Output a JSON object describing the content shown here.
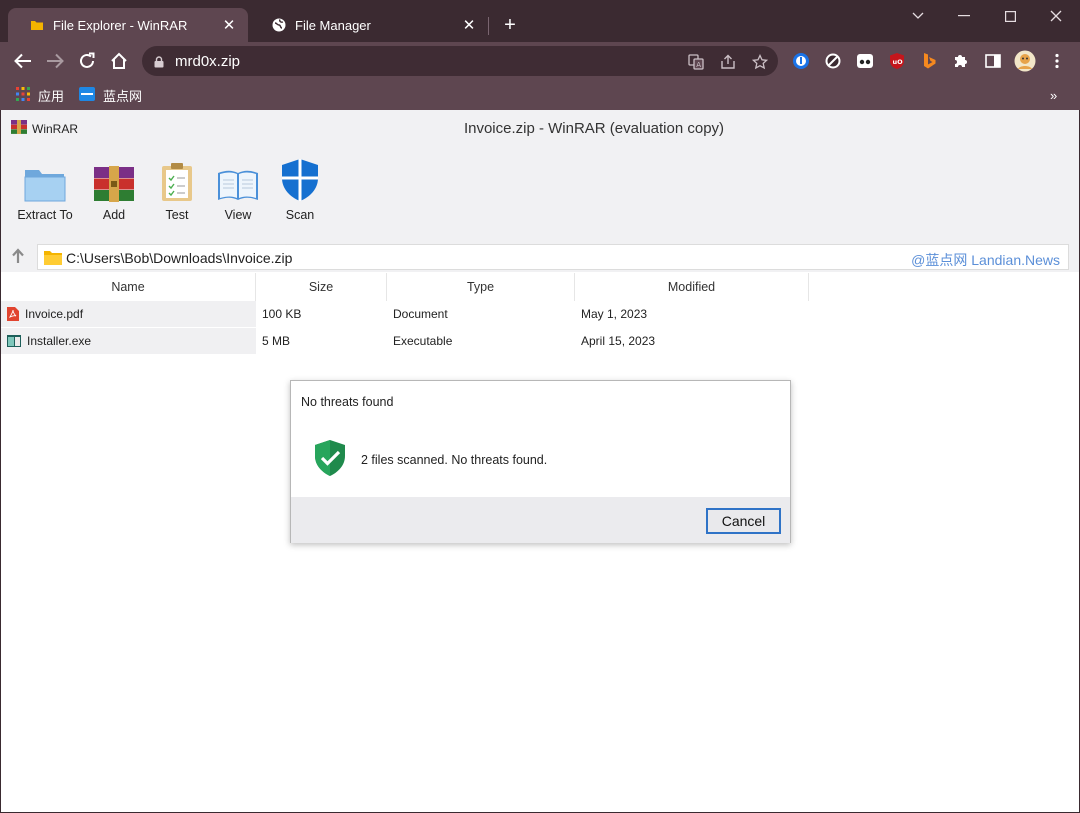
{
  "browser": {
    "tabs": [
      {
        "title": "File Explorer - WinRAR",
        "icon": "folder-icon",
        "active": true
      },
      {
        "title": "File Manager",
        "icon": "globe-icon",
        "active": false
      }
    ],
    "new_tab_label": "+",
    "address": "mrd0x.zip",
    "bookmarks": [
      {
        "label": "应用",
        "icon": "apps-grid-icon"
      },
      {
        "label": "蓝点网",
        "icon": "bookmark-site-icon"
      }
    ],
    "bookmarks_overflow": "»",
    "frame_color": "#3b2a31",
    "toolbar_color": "#5e4650"
  },
  "app": {
    "brand": "WinRAR",
    "window_title": "Invoice.zip - WinRAR (evaluation copy)",
    "tools": [
      {
        "label": "Extract To",
        "icon": "folder-icon"
      },
      {
        "label": "Add",
        "icon": "winrar-books-icon"
      },
      {
        "label": "Test",
        "icon": "clipboard-check-icon"
      },
      {
        "label": "View",
        "icon": "open-book-icon"
      },
      {
        "label": "Scan",
        "icon": "shield-icon"
      }
    ],
    "path": "C:\\Users\\Bob\\Downloads\\Invoice.zip",
    "watermark": "@蓝点网 Landian.News"
  },
  "file_list": {
    "columns": [
      "Name",
      "Size",
      "Type",
      "Modified"
    ],
    "rows": [
      {
        "name": "Invoice.pdf",
        "size": "100 KB",
        "type": "Document",
        "modified": "May 1, 2023",
        "icon": "pdf-icon"
      },
      {
        "name": "Installer.exe",
        "size": "5 MB",
        "type": "Executable",
        "modified": "April 15, 2023",
        "icon": "exe-icon"
      }
    ]
  },
  "dialog": {
    "title": "No threats found",
    "message": "2 files scanned. No threats found.",
    "icon": "shield-check-icon",
    "cancel_label": "Cancel",
    "accent_color": "#2f73c7",
    "shield_color": "#1f8a4c"
  }
}
